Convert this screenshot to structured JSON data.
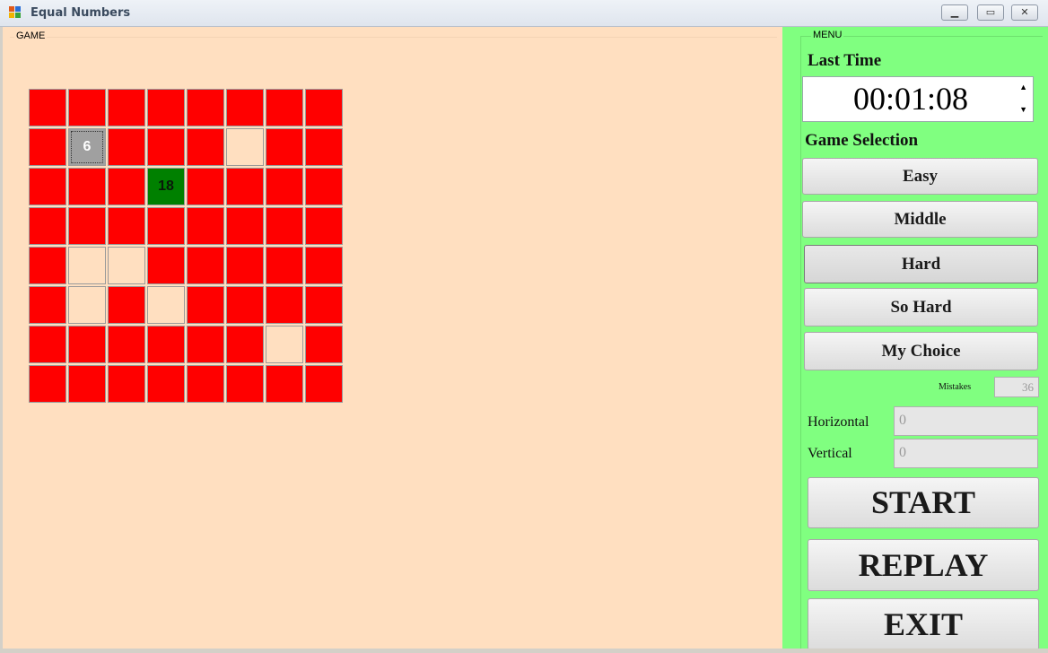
{
  "window": {
    "title": "Equal Numbers"
  },
  "game": {
    "legend": "GAME",
    "grid": [
      [
        "red",
        "red",
        "red",
        "red",
        "red",
        "red",
        "red",
        "red"
      ],
      [
        "red",
        "gray",
        "red",
        "red",
        "red",
        "empty",
        "red",
        "red"
      ],
      [
        "red",
        "red",
        "red",
        "green",
        "red",
        "red",
        "red",
        "red"
      ],
      [
        "red",
        "red",
        "red",
        "red",
        "red",
        "red",
        "red",
        "red"
      ],
      [
        "red",
        "empty",
        "empty",
        "red",
        "red",
        "red",
        "red",
        "red"
      ],
      [
        "red",
        "empty",
        "red",
        "empty",
        "red",
        "red",
        "red",
        "red"
      ],
      [
        "red",
        "red",
        "red",
        "red",
        "red",
        "red",
        "empty",
        "red"
      ],
      [
        "red",
        "red",
        "red",
        "red",
        "red",
        "red",
        "red",
        "red"
      ]
    ],
    "labels": {
      "1,1": "6",
      "2,3": "18"
    }
  },
  "menu": {
    "legend": "MENU",
    "last_time_label": "Last Time",
    "last_time_value": "00:01:08",
    "game_selection_label": "Game Selection",
    "buttons": {
      "easy": "Easy",
      "middle": "Middle",
      "hard": "Hard",
      "so_hard": "So Hard",
      "my_choice": "My Choice"
    },
    "mistakes_label": "Mistakes",
    "mistakes_value": "36",
    "horizontal_label": "Horizontal",
    "horizontal_value": "0",
    "vertical_label": "Vertical",
    "vertical_value": "0",
    "start": "START",
    "replay": "REPLAY",
    "exit": "EXIT"
  },
  "colors": {
    "cell_red": "#ff0000",
    "cell_empty": "#ffdfc0",
    "cell_green": "#008000",
    "cell_selected": "#a0a0a0",
    "menu_bg": "#80ff80",
    "game_bg": "#ffdfc0"
  }
}
